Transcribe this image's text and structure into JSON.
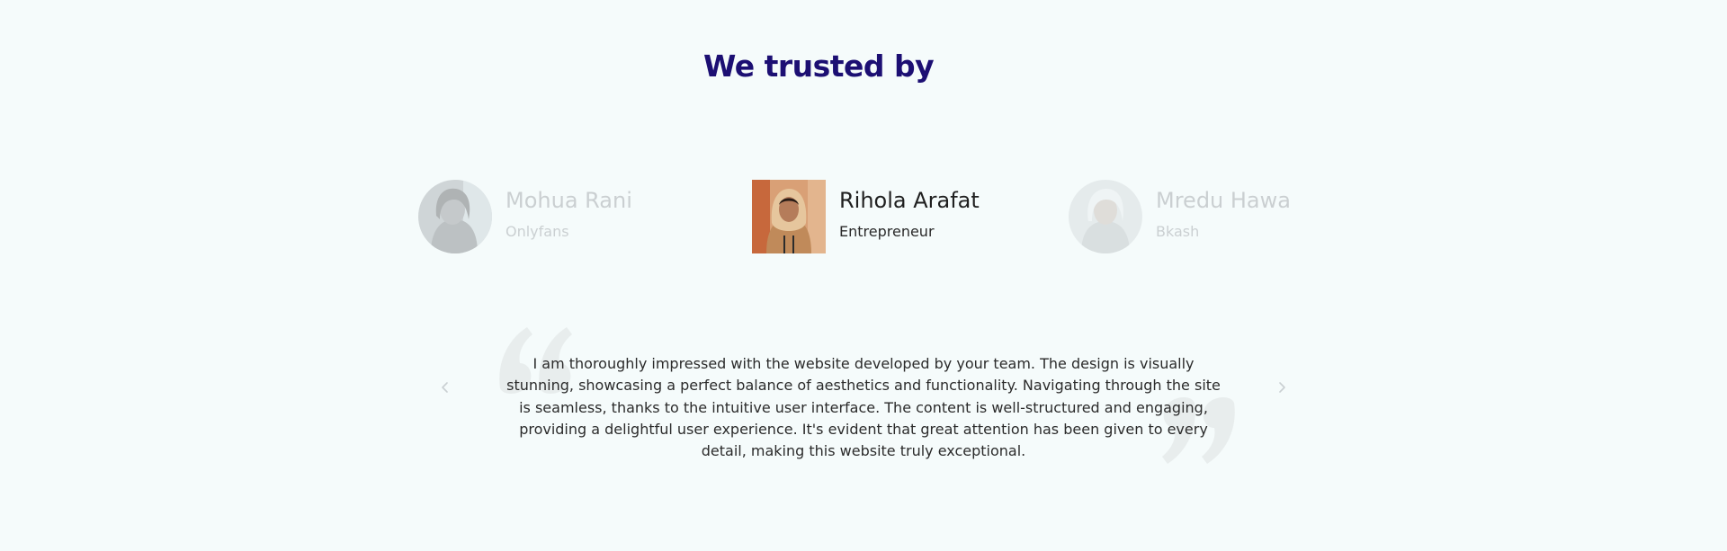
{
  "section": {
    "title": "We trusted by"
  },
  "testimonials": [
    {
      "name": "Mohua Rani",
      "role": "Onlyfans",
      "state": "inactive",
      "avatar_icon": "woman-portrait-icon"
    },
    {
      "name": "Rihola Arafat",
      "role": "Entrepreneur",
      "state": "active",
      "avatar_icon": "woman-hijab-portrait-icon"
    },
    {
      "name": "Mredu Hawa",
      "role": "Bkash",
      "state": "inactive",
      "avatar_icon": "elderly-woman-portrait-icon"
    }
  ],
  "active_quote": "I am thoroughly impressed with the website developed by your team. The design is visually stunning, showcasing a perfect balance of aesthetics and functionality. Navigating through the site is seamless, thanks to the intuitive user interface. The content is well-structured and engaging, providing a delightful user experience. It's evident that great attention has been given to every detail, making this website truly exceptional.",
  "navigation": {
    "prev_icon": "chevron-left-icon",
    "next_icon": "chevron-right-icon"
  },
  "colors": {
    "background": "#f5fbfb",
    "title": "#1c0f73",
    "text": "#2b2b2b",
    "quote_mark": "#e8eded",
    "nav_arrow": "#c9cfd2"
  }
}
